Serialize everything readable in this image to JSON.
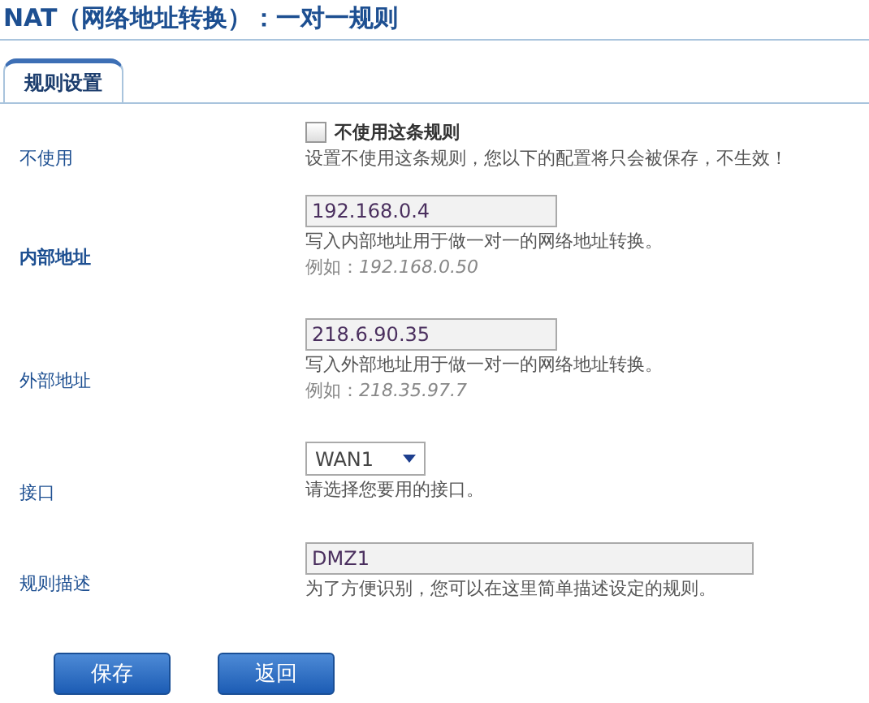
{
  "title": "NAT（网络地址转换）：一对一规则",
  "tabs": [
    {
      "label": "规则设置",
      "selected": true
    }
  ],
  "rows": [
    {
      "kind": "checkbox",
      "label": "不使用",
      "highlighted": false,
      "checked": false,
      "option": "不使用这条规则",
      "hint": "设置不使用这条规则，您以下的配置将只会被保存，不生效！"
    },
    {
      "kind": "text",
      "label": "内部地址",
      "highlighted": true,
      "value": "192.168.0.4",
      "hint": "写入内部地址用于做一对一的网络地址转换。",
      "example_label": "例如：",
      "example": "192.168.0.50"
    },
    {
      "kind": "text",
      "label": "外部地址",
      "highlighted": false,
      "value": "218.6.90.35",
      "hint": "写入外部地址用于做一对一的网络地址转换。",
      "example_label": "例如：",
      "example": "218.35.97.7"
    },
    {
      "kind": "select",
      "label": "接口",
      "highlighted": false,
      "value": "WAN1",
      "hint": "请选择您要用的接口。"
    },
    {
      "kind": "wide",
      "label": "规则描述",
      "highlighted": false,
      "value": "DMZ1",
      "hint": "为了方便识别，您可以在这里简单描述设定的规则。"
    }
  ],
  "buttons": [
    "保存",
    "返回"
  ]
}
